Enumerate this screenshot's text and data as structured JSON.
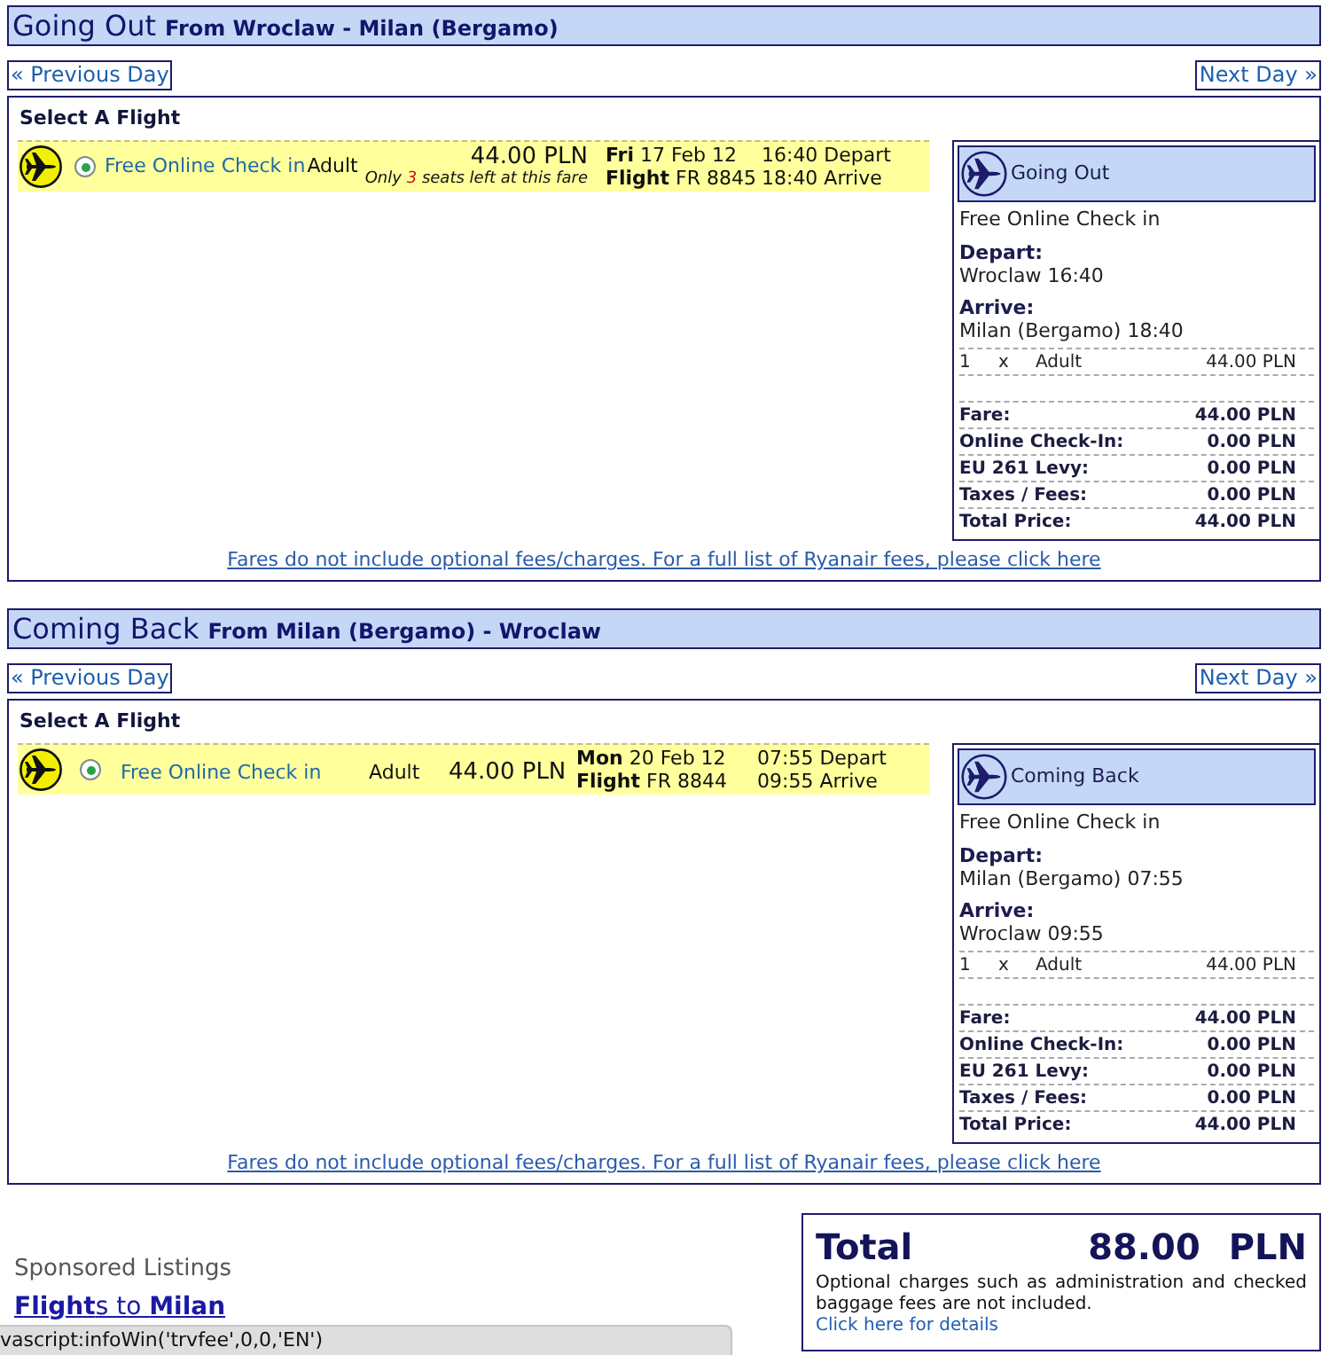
{
  "journeys": [
    {
      "heading": {
        "title": "Going Out",
        "route": "From Wroclaw - Milan (Bergamo)"
      },
      "previous_day": "« Previous Day",
      "next_day": "Next Day »",
      "panel_title": "Select A Flight",
      "flights": [
        {
          "selected": true,
          "check_in": "Free Online Check in",
          "passenger": "Adult",
          "price": "44.00 PLN",
          "seats_note": {
            "prefix": "Only",
            "count": "3",
            "suffix": "seats left at this fare"
          },
          "date": "**Fri** 17 Feb 12",
          "flight": "**Flight** FR 8845",
          "depart": "16:40 Depart",
          "arrive": "18:40 Arrive"
        }
      ],
      "summary": {
        "title": "Going Out",
        "check_in": "Free Online Check in",
        "depart_label": "Depart:",
        "depart": "Wroclaw 16:40",
        "arrive_label": "Arrive:",
        "arrive": "Milan (Bergamo) 18:40",
        "passengers": [
          {
            "count": "1",
            "times": "x",
            "type": "Adult",
            "amount": "44.00 PLN"
          }
        ],
        "charges": [
          {
            "label": "Fare:",
            "amount": "44.00 PLN"
          },
          {
            "label": "Online Check-In:",
            "amount": "0.00 PLN"
          },
          {
            "label": "EU 261 Levy:",
            "amount": "0.00 PLN"
          },
          {
            "label": "Taxes / Fees:",
            "amount": "0.00 PLN"
          },
          {
            "label": "Total Price:",
            "amount": "44.00 PLN"
          }
        ]
      },
      "fees_link": "Fares do not include optional fees/charges. For a full list of Ryanair fees, please click here"
    },
    {
      "heading": {
        "title": "Coming Back",
        "route": "From Milan (Bergamo) - Wroclaw"
      },
      "previous_day": "« Previous Day",
      "next_day": "Next Day »",
      "panel_title": "Select A Flight",
      "flights": [
        {
          "selected": true,
          "check_in": "Free Online Check in",
          "passenger": "Adult",
          "price": "44.00 PLN",
          "date": "**Mon** 20 Feb 12",
          "flight": "**Flight** FR 8844",
          "depart": "07:55 Depart",
          "arrive": "09:55 Arrive"
        }
      ],
      "summary": {
        "title": "Coming Back",
        "check_in": "Free Online Check in",
        "depart_label": "Depart:",
        "depart": "Milan (Bergamo) 07:55",
        "arrive_label": "Arrive:",
        "arrive": "Wroclaw 09:55",
        "passengers": [
          {
            "count": "1",
            "times": "x",
            "type": "Adult",
            "amount": "44.00 PLN"
          }
        ],
        "charges": [
          {
            "label": "Fare:",
            "amount": "44.00 PLN"
          },
          {
            "label": "Online Check-In:",
            "amount": "0.00 PLN"
          },
          {
            "label": "EU 261 Levy:",
            "amount": "0.00 PLN"
          },
          {
            "label": "Taxes / Fees:",
            "amount": "0.00 PLN"
          },
          {
            "label": "Total Price:",
            "amount": "44.00 PLN"
          }
        ]
      },
      "fees_link": "Fares do not include optional fees/charges. For a full list of Ryanair fees, please click here"
    }
  ],
  "sponsored": {
    "heading": "Sponsored Listings",
    "link": "**Flight**s to **Milan**"
  },
  "total": {
    "label": "Total",
    "amount": "88.00",
    "currency": "PLN",
    "note": "Optional charges such as administration and checked baggage fees are not included.",
    "link": "Click here for details"
  },
  "status_bar": "vascript:infoWin('trvfee',0,0,'EN')"
}
